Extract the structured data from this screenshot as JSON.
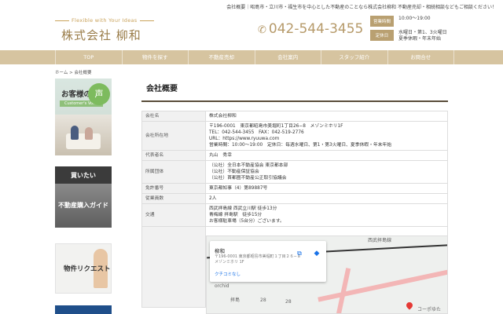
{
  "top_line": "会社概要｜昭島市・立川市・福生市を中心とした不動産のことなら株式会社柳和 不動産売却・相続相談などもご相談ください！",
  "logo": {
    "tagline": "Flexible with Your Ideas",
    "name": "株式会社 柳和"
  },
  "phone": "042-544-3455",
  "hours": {
    "hours_label": "営業時間",
    "hours_value": "10:00〜19:00",
    "closed_label": "定休日",
    "closed_value_1": "水曜日・第1、3火曜日",
    "closed_value_2": "夏季休暇・年末年始"
  },
  "nav": [
    "TOP",
    "物件を探す",
    "不動産売却",
    "会社案内",
    "スタッフ紹介",
    "お問合せ"
  ],
  "breadcrumb": {
    "home": "ホーム",
    "sep": " > ",
    "current": "会社概要"
  },
  "sidebar": {
    "voice_title": "お客様の",
    "voice_sub": "Customer's Voice",
    "voice_bubble": "声",
    "buy_title": "買いたい",
    "buy_guide": "不動産購入ガイド",
    "request_title": "物件リクエスト"
  },
  "main": {
    "title": "会社概要",
    "rows": [
      {
        "label": "会社名",
        "lines": [
          "株式会社柳和"
        ]
      },
      {
        "label": "会社所在地",
        "lines": [
          "〒196-0001　東京都昭島市美堀町1丁目26−8　メゾンミホリ1F",
          "TEL：042-544-3455　FAX：042-519-2776",
          "URL：https://www.ryuuwa.com",
          "営業時間：10:00〜19:00　定休日：毎週水曜日、第1・第3火曜日、夏季休暇・年末年始"
        ]
      },
      {
        "label": "代表者名",
        "lines": [
          "丸山　秀幸"
        ]
      },
      {
        "label": "所属団体",
        "lines": [
          "（公社）全日本不動産協会 東京都本部",
          "（公社）不動産保証協会",
          "（公社）首都圏不動産公正取引協議会"
        ]
      },
      {
        "label": "免許番号",
        "lines": [
          "東京都知事（4）第89887号"
        ]
      },
      {
        "label": "従業員数",
        "lines": [
          "2人"
        ]
      },
      {
        "label": "交通",
        "lines": [
          "西武拝島線 西武立川駅 徒歩13分",
          "青梅線 拝島駅　徒歩15分",
          "お客様駐車場（5台分）ございます。"
        ]
      }
    ]
  },
  "map": {
    "place_name": "柳和",
    "place_address": "〒196-0001 東京都昭島市美堀町１丁目２６−８ メゾンミホリ 1F",
    "reviews_link": "クチコミなし",
    "labels": [
      "orchid",
      "拝島",
      "28",
      "28",
      "西武拝島線",
      "コーポゆた"
    ]
  }
}
